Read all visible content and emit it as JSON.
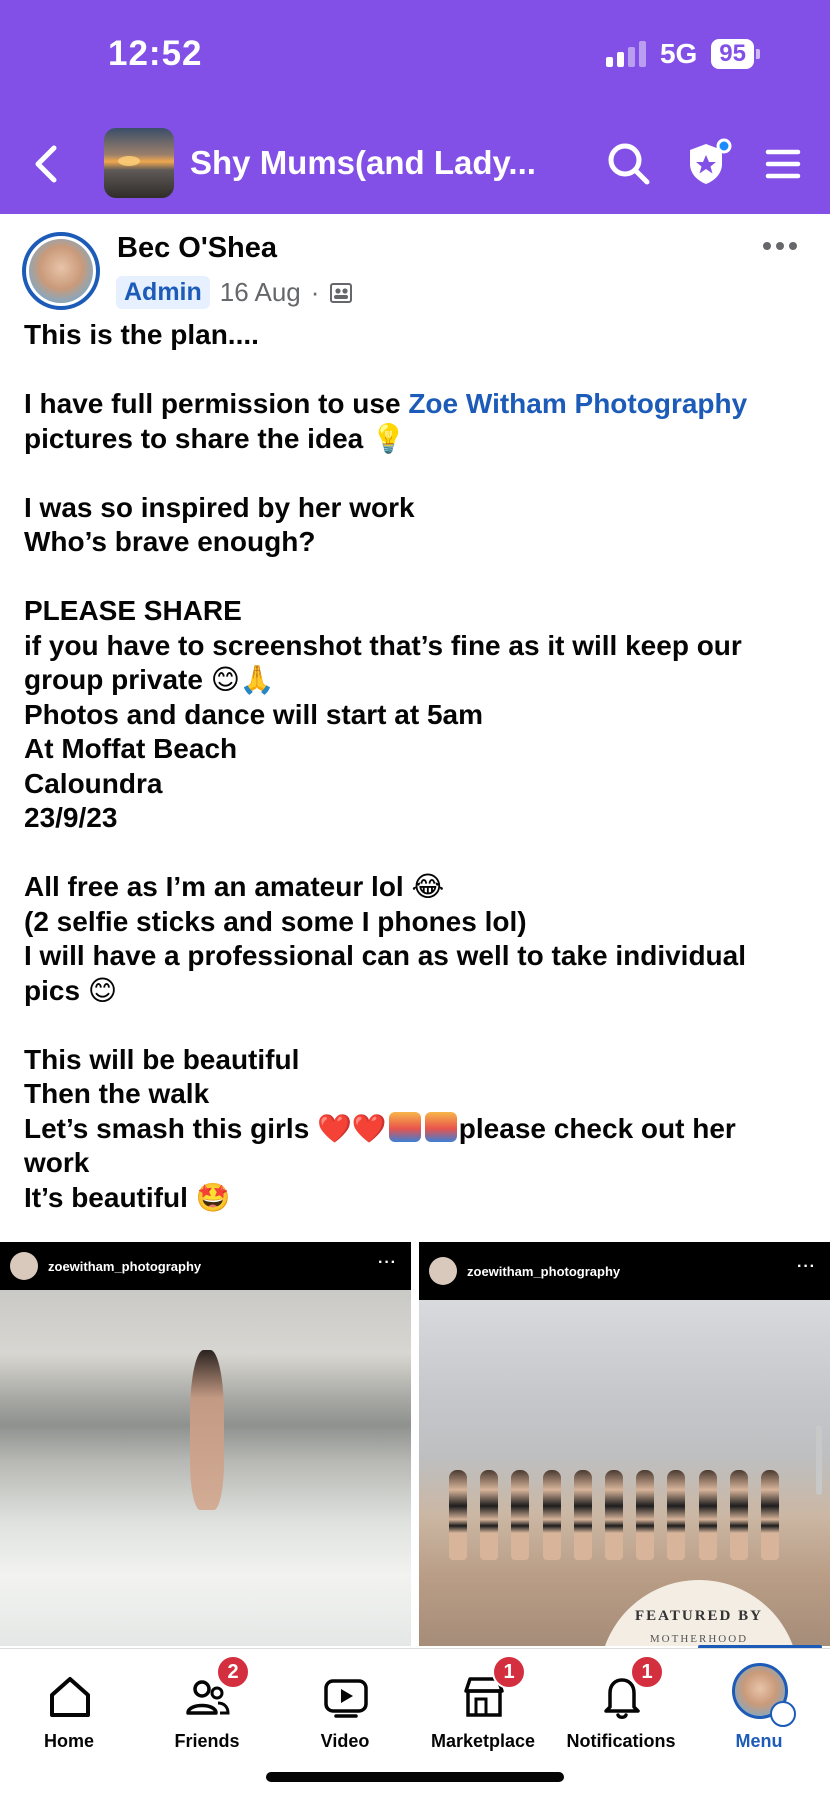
{
  "status_bar": {
    "time": "12:52",
    "network": "5G",
    "battery": "95"
  },
  "header": {
    "group_title": "Shy Mums(and Lady...",
    "icons": [
      "back-icon",
      "search-icon",
      "shield-star-icon",
      "hamburger-menu-icon"
    ]
  },
  "post": {
    "author": "Bec O'Shea",
    "role_badge": "Admin",
    "date": "16 Aug",
    "separator": "·",
    "text": {
      "l1": "This is the plan....",
      "l2a": "I have full permission to use ",
      "l2_link": "Zoe Witham Photography",
      "l3": "pictures to share the idea",
      "l3_emoji": "💡",
      "l4": "I was so inspired by her work",
      "l5": "Who’s brave enough?",
      "l6": "PLEASE SHARE",
      "l7": "if you have to screenshot that’s fine as it will keep our",
      "l8": "group private",
      "l8_emoji": "😊🙏",
      "l9": "Photos and dance will start at 5am",
      "l10": "At Moffat Beach",
      "l11": "Caloundra",
      "l12": "23/9/23",
      "l13": "All free as I’m an amateur lol",
      "l13_emoji": "😂",
      "l14": "(2 selfie sticks and some I phones lol)",
      "l15": "I will have a professional can as well to take individual",
      "l16": "pics",
      "l16_emoji": "😊",
      "l17": "This will be beautiful",
      "l18": "Then the walk",
      "l19a": "Let’s smash this girls",
      "l19_emoji": "❤️❤️",
      "l19b": "please check out her",
      "l20": "work",
      "l21": "It’s beautiful",
      "l21_emoji": "🤩"
    },
    "photos": [
      {
        "username": "zoewitham_photography",
        "dots": "···"
      },
      {
        "username": "zoewitham_photography",
        "dots": "···",
        "overlay_text": "FEATURED BY",
        "overlay_sub": "MOTHERHOOD"
      }
    ]
  },
  "bottom_nav": [
    {
      "label": "Home",
      "icon": "home-icon",
      "badge": ""
    },
    {
      "label": "Friends",
      "icon": "friends-icon",
      "badge": "2"
    },
    {
      "label": "Video",
      "icon": "video-icon",
      "badge": ""
    },
    {
      "label": "Marketplace",
      "icon": "marketplace-icon",
      "badge": "1"
    },
    {
      "label": "Notifications",
      "icon": "bell-icon",
      "badge": "1"
    },
    {
      "label": "Menu",
      "icon": "menu-avatar-icon",
      "badge": ""
    }
  ],
  "colors": {
    "brand": "#8250e6",
    "link": "#1c5bb8",
    "badge": "#d32f3f"
  }
}
